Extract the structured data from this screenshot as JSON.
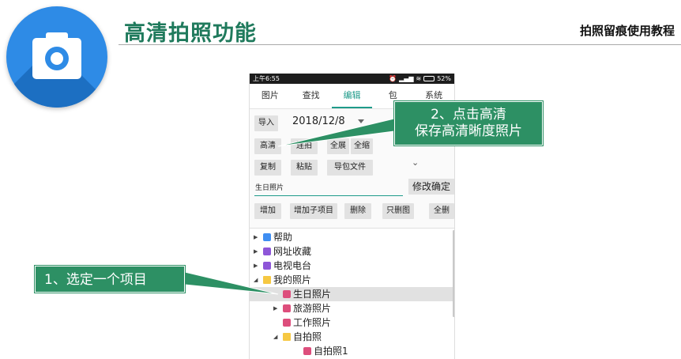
{
  "header": {
    "title": "高清拍照功能",
    "subtitle": "拍照留痕使用教程",
    "logo_icon": "camera-icon",
    "accent_color": "#1f7a5c",
    "logo_color": "#2e8be6"
  },
  "phone": {
    "status": {
      "time": "上午6:55",
      "battery": "52%"
    },
    "tabs": [
      "图片",
      "查找",
      "编辑",
      "包",
      "系统"
    ],
    "active_tab": "编辑",
    "toolbar": {
      "import_label": "导入",
      "date_value": "2018/12/8",
      "hd_label": "高清",
      "burst_label": "连拍",
      "expand_all_label": "全展",
      "collapse_all_label": "全缩",
      "copy_label": "复制",
      "paste_label": "粘贴",
      "export_pack_label": "导包文件"
    },
    "name_field": {
      "value": "生日照片"
    },
    "confirm_label": "修改确定",
    "actions": {
      "add_label": "增加",
      "add_child_label": "增加子项目",
      "delete_label": "删除",
      "delete_image_only_label": "只删图",
      "delete_all_label": "全删"
    },
    "tree": [
      {
        "label": "帮助",
        "icon": "help-icon"
      },
      {
        "label": "网址收藏",
        "icon": "link-icon"
      },
      {
        "label": "电视电台",
        "icon": "link-icon"
      },
      {
        "label": "我的照片",
        "icon": "folder-icon"
      },
      {
        "label": "生日照片",
        "icon": "photo-icon",
        "selected": true
      },
      {
        "label": "旅游照片",
        "icon": "photo-icon"
      },
      {
        "label": "工作照片",
        "icon": "photo-icon"
      },
      {
        "label": "自拍照",
        "icon": "folder-icon"
      },
      {
        "label": "自拍照1",
        "icon": "photo-icon"
      }
    ]
  },
  "callouts": {
    "step1": "1、选定一个项目",
    "step2_line1": "2、点击高清",
    "step2_line2": "保存高清晰度照片",
    "color": "#2d9064"
  }
}
